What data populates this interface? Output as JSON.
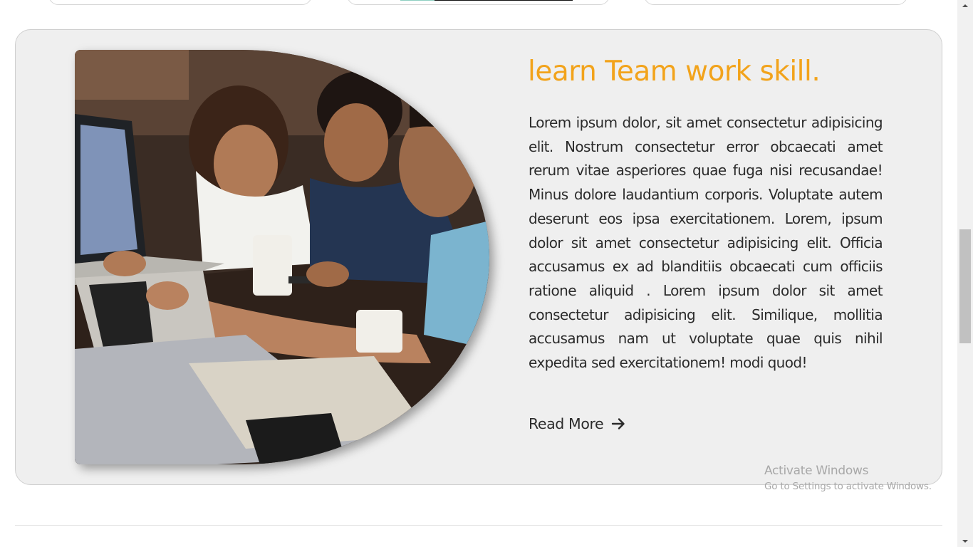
{
  "feature": {
    "title": "learn Team work skill.",
    "body": "Lorem ipsum dolor, sit amet consectetur adipisicing elit. Nostrum consectetur error obcaecati amet rerum vitae asperiores quae fuga nisi recusandae! Minus dolore laudantium corporis. Voluptate autem deserunt eos ipsa exercitationem. Lorem, ipsum dolor sit amet consectetur adipisicing elit. Officia accusamus ex ad blanditiis obcaecati cum officiis ratione aliquid . Lorem ipsum dolor sit amet consectetur adipisicing elit. Similique, mollitia accusamus nam ut voluptate quae quis nihil expedita sed exercitationem! modi quod!",
    "read_more_label": "Read More",
    "read_more_icon": "arrow-right-icon",
    "image_icon": "team-photo"
  },
  "watermark": {
    "line1": "Activate Windows",
    "line2": "Go to Settings to activate Windows."
  },
  "colors": {
    "accent": "#f2a31b",
    "card_bg": "#efefef",
    "text": "#2b2b2b"
  }
}
